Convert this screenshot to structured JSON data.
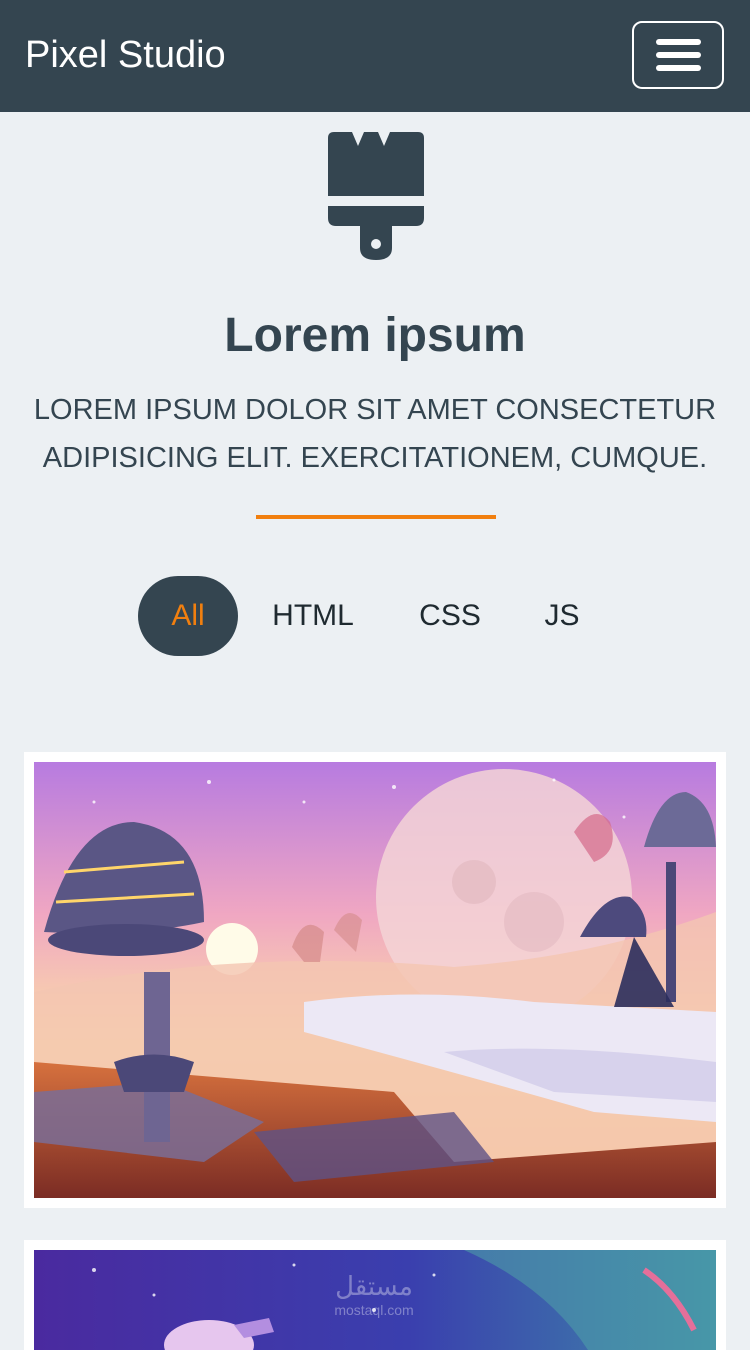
{
  "navbar": {
    "brand": "Pixel Studio",
    "menu_icon": "hamburger-menu-icon"
  },
  "hero": {
    "icon": "paint-brush-icon",
    "title": "Lorem ipsum",
    "subtitle": "LOREM IPSUM DOLOR SIT AMET CONSECTETUR ADIPISICING ELIT. EXERCITATIONEM, CUMQUE."
  },
  "filters": {
    "items": [
      "All",
      "HTML",
      "CSS",
      "JS"
    ],
    "active": "All"
  },
  "colors": {
    "navbar_bg": "#344550",
    "page_bg": "#ecf0f3",
    "accent": "#f17f0f",
    "text_dark": "#344550"
  },
  "watermark": {
    "arabic": "مستقل",
    "latin": "mostaql.com"
  }
}
